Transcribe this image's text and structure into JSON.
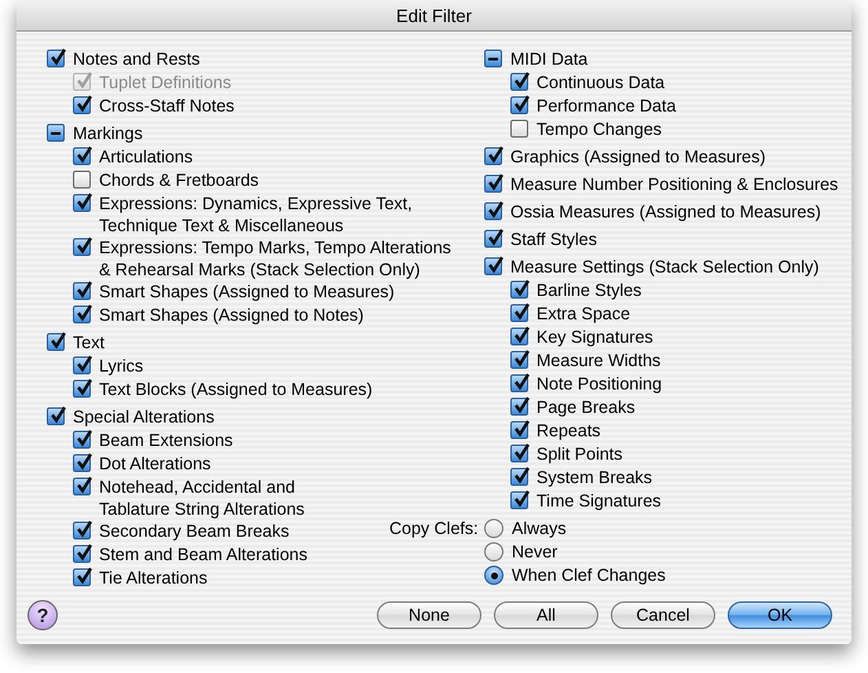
{
  "window": {
    "title": "Edit Filter"
  },
  "columns": [
    {
      "items": [
        {
          "label": "Notes and Rests",
          "checked": true,
          "children": [
            {
              "label": "Tuplet Definitions",
              "checked": true,
              "disabled": true
            },
            {
              "label": "Cross-Staff Notes",
              "checked": true,
              "disabled": false
            }
          ]
        },
        {
          "label": "Markings",
          "checked": true,
          "mixed": true,
          "children": [
            {
              "label": "Articulations",
              "checked": true,
              "disabled": false
            },
            {
              "label": "Chords & Fretboards",
              "checked": false,
              "disabled": false
            },
            {
              "label": "Expressions: Dynamics, Expressive Text,\nTechnique Text & Miscellaneous",
              "checked": true,
              "disabled": false
            },
            {
              "label": "Expressions: Tempo Marks, Tempo Alterations\n& Rehearsal Marks (Stack Selection Only)",
              "checked": true,
              "disabled": false
            },
            {
              "label": "Smart Shapes (Assigned to Measures)",
              "checked": true,
              "disabled": false
            },
            {
              "label": "Smart Shapes (Assigned to Notes)",
              "checked": true,
              "disabled": false
            }
          ]
        },
        {
          "label": "Text",
          "checked": true,
          "children": [
            {
              "label": "Lyrics",
              "checked": true,
              "disabled": false
            },
            {
              "label": "Text Blocks (Assigned to Measures)",
              "checked": true,
              "disabled": false
            }
          ]
        },
        {
          "label": "Special Alterations",
          "checked": true,
          "children": [
            {
              "label": "Beam Extensions",
              "checked": true,
              "disabled": false
            },
            {
              "label": "Dot Alterations",
              "checked": true,
              "disabled": false
            },
            {
              "label": "Notehead, Accidental and\nTablature String Alterations",
              "checked": true,
              "disabled": false
            },
            {
              "label": "Secondary Beam Breaks",
              "checked": true,
              "disabled": false
            },
            {
              "label": "Stem and Beam Alterations",
              "checked": true,
              "disabled": false
            },
            {
              "label": "Tie Alterations",
              "checked": true,
              "disabled": false
            }
          ]
        }
      ]
    },
    {
      "items": [
        {
          "label": "MIDI Data",
          "checked": true,
          "mixed": true,
          "children": [
            {
              "label": "Continuous Data",
              "checked": true,
              "disabled": false
            },
            {
              "label": "Performance Data",
              "checked": true,
              "disabled": false
            },
            {
              "label": "Tempo Changes",
              "checked": false,
              "disabled": false
            }
          ]
        },
        {
          "label": "Graphics (Assigned to Measures)",
          "checked": true
        },
        {
          "label": "Measure Number Positioning & Enclosures",
          "checked": true
        },
        {
          "label": "Ossia Measures (Assigned to Measures)",
          "checked": true
        },
        {
          "label": "Staff Styles",
          "checked": true
        },
        {
          "label": "Measure Settings (Stack Selection Only)",
          "checked": true,
          "children": [
            {
              "label": "Barline Styles",
              "checked": true,
              "disabled": false
            },
            {
              "label": "Extra Space",
              "checked": true,
              "disabled": false
            },
            {
              "label": "Key Signatures",
              "checked": true,
              "disabled": false
            },
            {
              "label": "Measure Widths",
              "checked": true,
              "disabled": false
            },
            {
              "label": "Note Positioning",
              "checked": true,
              "disabled": false
            },
            {
              "label": "Page Breaks",
              "checked": true,
              "disabled": false
            },
            {
              "label": "Repeats",
              "checked": true,
              "disabled": false
            },
            {
              "label": "Split Points",
              "checked": true,
              "disabled": false
            },
            {
              "label": "System Breaks",
              "checked": true,
              "disabled": false
            },
            {
              "label": "Time Signatures",
              "checked": true,
              "disabled": false
            }
          ]
        }
      ]
    }
  ],
  "copy_clefs": {
    "label": "Copy Clefs:",
    "options": [
      {
        "label": "Always",
        "selected": false
      },
      {
        "label": "Never",
        "selected": false
      },
      {
        "label": "When Clef Changes",
        "selected": true
      }
    ]
  },
  "help_button": {
    "label": "?"
  },
  "buttons": [
    {
      "label": "None",
      "default": false
    },
    {
      "label": "All",
      "default": false
    },
    {
      "label": "Cancel",
      "default": false
    },
    {
      "label": "OK",
      "default": true
    }
  ]
}
